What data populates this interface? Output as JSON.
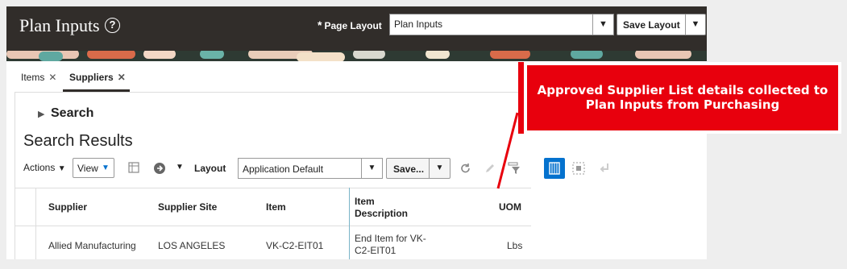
{
  "header": {
    "title": "Plan Inputs",
    "required_marker": "*",
    "page_layout_label": "Page Layout",
    "page_layout_value": "Plan Inputs",
    "save_layout_label": "Save Layout"
  },
  "tabs": [
    {
      "label": "Items",
      "active": false
    },
    {
      "label": "Suppliers",
      "active": true
    }
  ],
  "search": {
    "label": "Search"
  },
  "results": {
    "title": "Search Results",
    "toolbar": {
      "actions_label": "Actions",
      "view_label": "View",
      "layout_label": "Layout",
      "layout_value": "Application Default",
      "save_label": "Save..."
    }
  },
  "table": {
    "columns": [
      "Supplier",
      "Supplier Site",
      "Item",
      "Item Description",
      "UOM"
    ],
    "rows": [
      {
        "supplier": "Allied Manufacturing",
        "site": "LOS ANGELES",
        "item": "VK-C2-EIT01",
        "description": "End Item for VK-C2-EIT01",
        "uom": "Lbs"
      }
    ]
  },
  "callout": {
    "text": "Approved Supplier List details collected to Plan Inputs from Purchasing",
    "color": "#e8000d"
  },
  "colors": {
    "header_bg": "#312d2a",
    "accent_blue": "#0572ce"
  }
}
